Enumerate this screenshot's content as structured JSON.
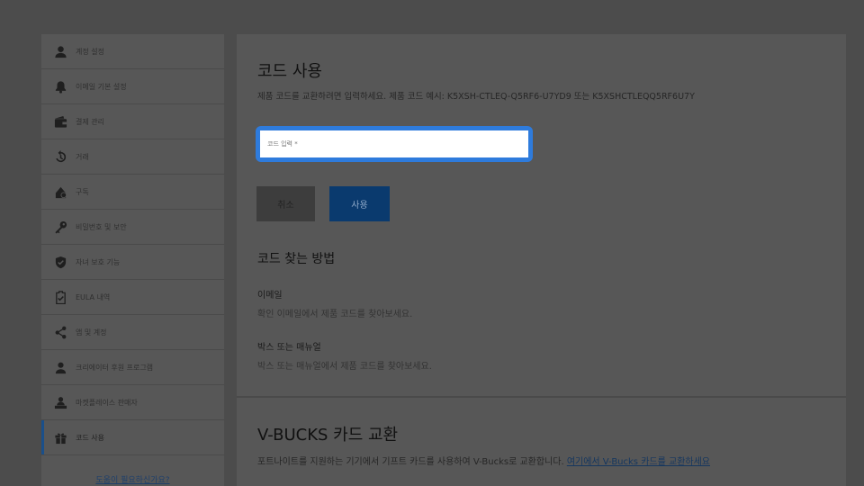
{
  "sidebar": {
    "items": [
      {
        "label": "계정 설정",
        "icon": "person-icon"
      },
      {
        "label": "이메일 기본 설정",
        "icon": "bell-icon"
      },
      {
        "label": "결제 관리",
        "icon": "wallet-icon"
      },
      {
        "label": "거래",
        "icon": "history-icon"
      },
      {
        "label": "구독",
        "icon": "subscription-icon"
      },
      {
        "label": "비밀번호 및 보안",
        "icon": "key-icon"
      },
      {
        "label": "자녀 보호 기능",
        "icon": "shield-icon"
      },
      {
        "label": "EULA 내역",
        "icon": "clipboard-check-icon"
      },
      {
        "label": "앱 및 계정",
        "icon": "share-icon"
      },
      {
        "label": "크리에이터 후원 프로그램",
        "icon": "creator-icon"
      },
      {
        "label": "마켓플레이스 판매자",
        "icon": "seller-icon"
      },
      {
        "label": "코드 사용",
        "icon": "gift-icon",
        "active": true
      }
    ],
    "help_link": "도움이 필요하신가요?"
  },
  "redeem": {
    "title": "코드 사용",
    "description": "제품 코드를 교환하려면 입력하세요. 제품 코드 예시: K5XSH-CTLEQ-Q5RF6-U7YD9 또는 K5XSHCTLEQQ5RF6U7Y",
    "input_placeholder": "코드 입력 *",
    "input_value": "",
    "cancel_label": "취소",
    "use_label": "사용"
  },
  "how_to": {
    "title": "코드 찾는 방법",
    "email_title": "이메일",
    "email_desc": "확인 이메일에서 제품 코드를 찾아보세요.",
    "box_title": "박스 또는 매뉴얼",
    "box_desc": "박스 또는 매뉴얼에서 제품 코드를 찾아보세요."
  },
  "vbucks": {
    "title": "V-BUCKS 카드 교환",
    "desc": "포트나이트를 지원하는 기기에서 기프트 카드를 사용하여 V-Bucks로 교환합니다.",
    "link": "여기에서 V-Bucks 카드를 교환하세요"
  },
  "colors": {
    "focus_ring": "#2e7bdc",
    "primary_button": "#0a3a6e",
    "active_indicator": "#1a4f8a"
  }
}
